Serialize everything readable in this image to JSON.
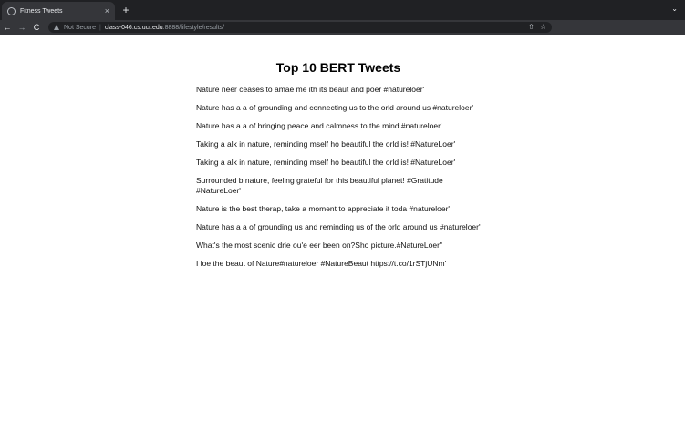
{
  "browser": {
    "tab_title": "Fitness Tweets",
    "tab_close": "×",
    "new_tab": "+",
    "tab_menu": "⌄",
    "back": "←",
    "forward": "→",
    "reload": "C",
    "security_label": "Not Secure",
    "separator": "|",
    "url_host": "class-046.cs.ucr.edu",
    "url_path": ":8888/lifestyle/results/",
    "share_glyph": "⇧",
    "star_glyph": "☆",
    "ext_glyph": "✦",
    "menu_glyph": "⋮",
    "extension_colors": [
      "#e53935",
      "#e53935"
    ]
  },
  "page": {
    "heading": "Top 10 BERT Tweets",
    "tweets": [
      "Nature neer ceases to amae me ith its beaut and poer #natureloer'",
      "Nature has a a of grounding and connecting us to the orld around us #natureloer'",
      "Nature has a a of bringing peace and calmness to the mind #natureloer'",
      "Taking a alk in nature, reminding mself ho beautiful the orld is! #NatureLoer'",
      "Taking a alk in nature, reminding mself ho beautiful the orld is! #NatureLoer'",
      "Surrounded b nature, feeling grateful for this beautiful planet! #Gratitude #NatureLoer'",
      "Nature is the best therap, take a moment to appreciate it toda #natureloer'",
      "Nature has a a of grounding us and reminding us of the orld around us #natureloer'",
      "What's the most scenic drie ou'e eer been on?Sho picture.#NatureLoer\"",
      "I loe the beaut of Nature#natureloer #NatureBeaut https://t.co/1rSTjUNm'"
    ]
  }
}
